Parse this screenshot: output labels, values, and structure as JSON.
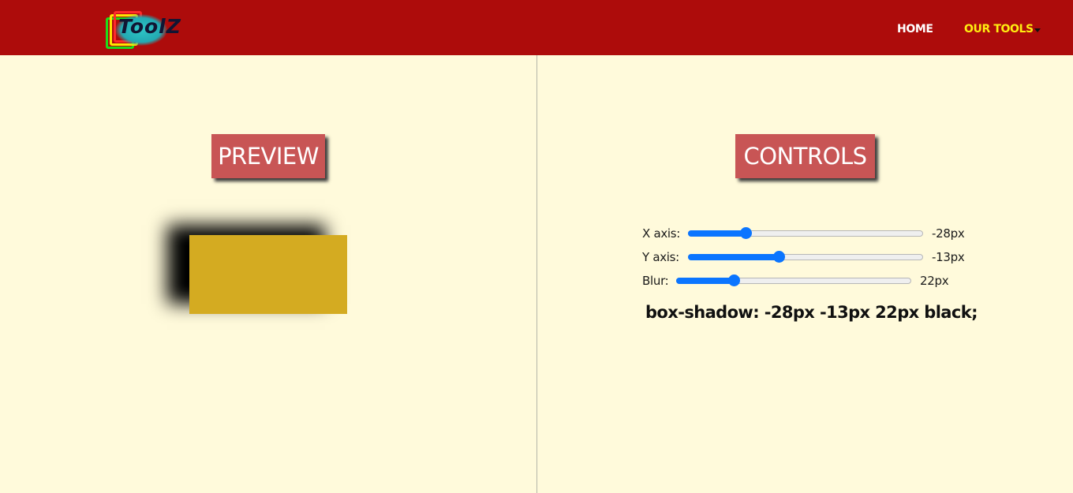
{
  "nav": {
    "logo_text": "ToolZ",
    "home_label": "HOME",
    "tools_label": "OUR TOOLS"
  },
  "preview": {
    "heading": "PREVIEW",
    "box_color": "#d4ab21",
    "shadow_color": "black"
  },
  "controls": {
    "heading": "CONTROLS",
    "x_axis": {
      "label": "X axis:",
      "value": "-28px",
      "level": 0.23
    },
    "y_axis": {
      "label": "Y axis:",
      "value": "-13px",
      "level": 0.38
    },
    "blur": {
      "label": "Blur:",
      "value": "22px",
      "level": 0.23
    },
    "output": "box-shadow: -28px -13px 22px black;"
  },
  "colors": {
    "navbar": "#ad0c0b",
    "background": "#fffadb",
    "heading_bg": "#c85555",
    "slider_accent": "#0b75ff",
    "nav_active": "#ffee10"
  }
}
